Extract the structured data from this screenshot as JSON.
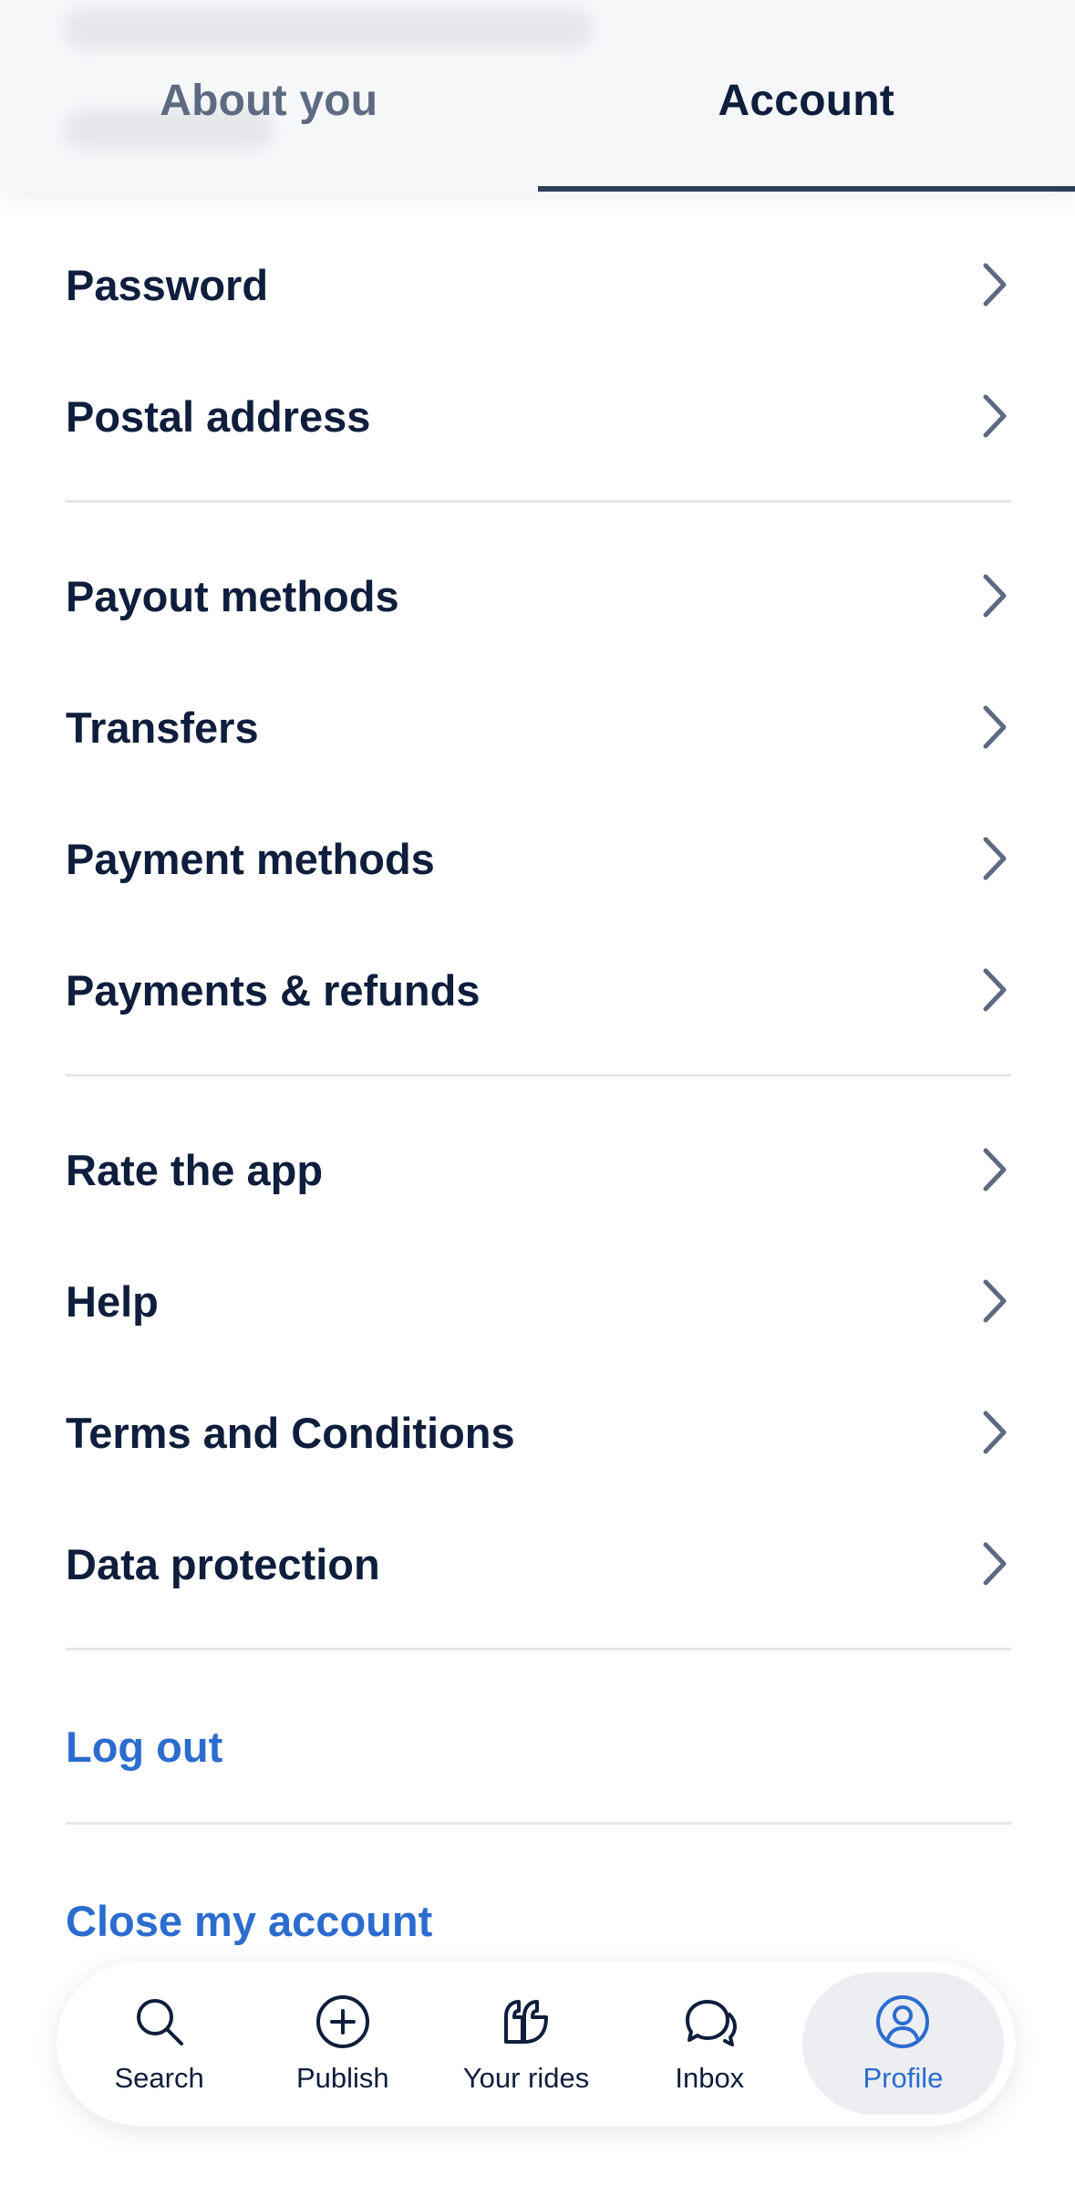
{
  "tabs": {
    "about": "About you",
    "account": "Account"
  },
  "sections": [
    {
      "items": [
        "Password",
        "Postal address"
      ]
    },
    {
      "items": [
        "Payout methods",
        "Transfers",
        "Payment methods",
        "Payments & refunds"
      ]
    },
    {
      "items": [
        "Rate the app",
        "Help",
        "Terms and Conditions",
        "Data protection"
      ]
    }
  ],
  "actions": {
    "logout": "Log out",
    "close_account": "Close my account"
  },
  "nav": {
    "items": [
      {
        "label": "Search",
        "icon": "search-icon"
      },
      {
        "label": "Publish",
        "icon": "plus-circle-icon"
      },
      {
        "label": "Your rides",
        "icon": "rides-icon"
      },
      {
        "label": "Inbox",
        "icon": "chat-icon"
      },
      {
        "label": "Profile",
        "icon": "profile-icon"
      }
    ],
    "active": "Profile"
  },
  "colors": {
    "text": "#0f1e3c",
    "muted": "#5d6a82",
    "accent": "#2b6ccf"
  }
}
